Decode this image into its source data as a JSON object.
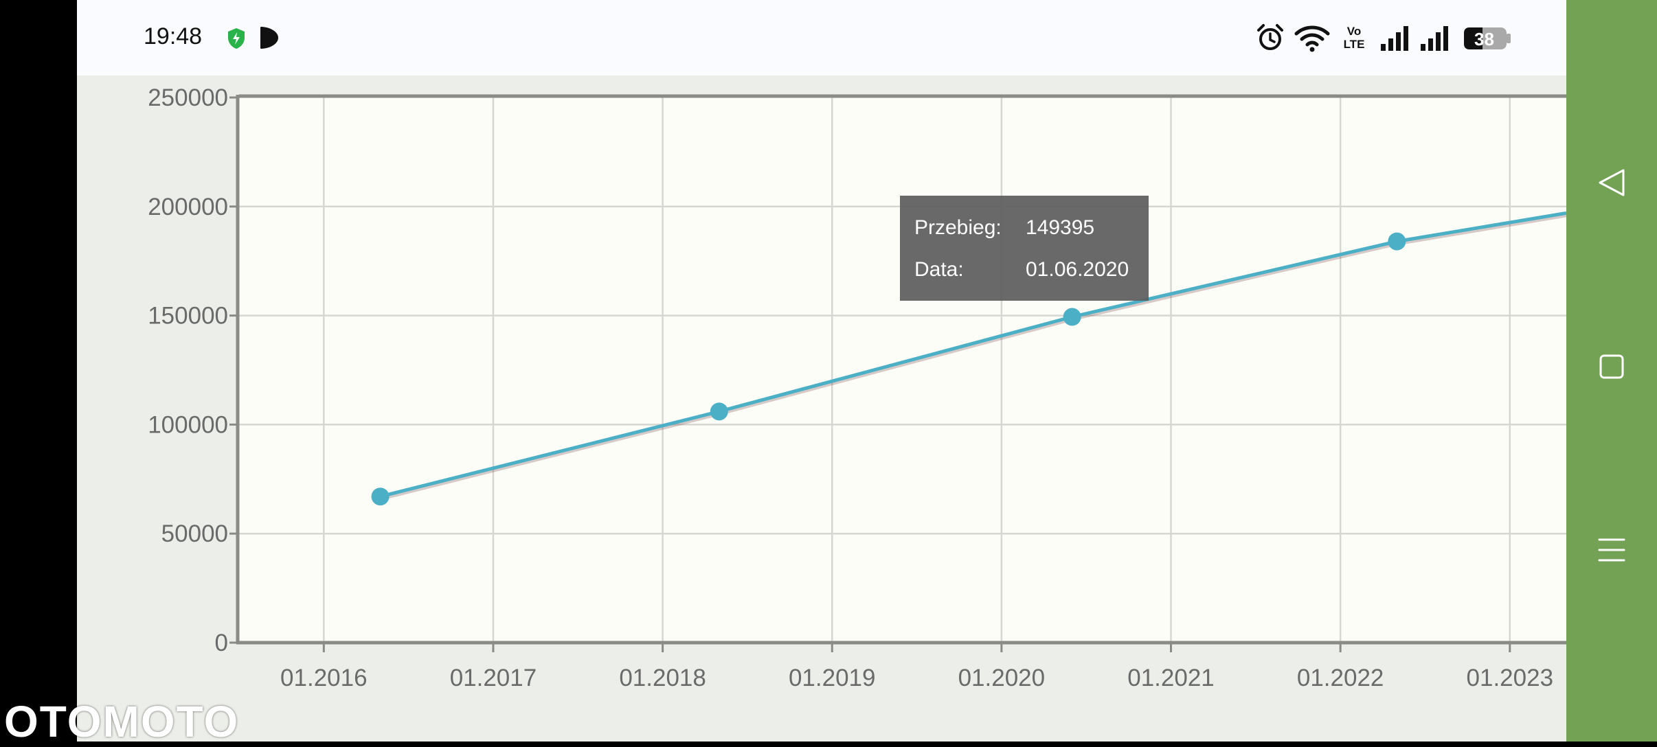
{
  "status_bar": {
    "time": "19:48",
    "battery": "38",
    "icons": [
      "shield-icon",
      "play-icon",
      "alarm-icon",
      "wifi-icon",
      "volte-icon",
      "signal-icon",
      "signal-icon",
      "battery-icon"
    ],
    "volte_text": "Vo LTE"
  },
  "chart_data": {
    "type": "line",
    "x_tick_labels": [
      "01.2016",
      "01.2017",
      "01.2018",
      "01.2019",
      "01.2020",
      "01.2021",
      "01.2022",
      "01.2023"
    ],
    "y_tick_labels": [
      "0",
      "50000",
      "100000",
      "150000",
      "200000",
      "250000"
    ],
    "ylim": [
      0,
      250000
    ],
    "xlim": [
      "2015-07",
      "2023-05"
    ],
    "grid": true,
    "series": [
      {
        "color": "#4bafc6",
        "points": [
          {
            "date": "2016-05",
            "value": 67000
          },
          {
            "date": "2018-05",
            "value": 106000
          },
          {
            "date": "2020-06",
            "value": 149395
          },
          {
            "date": "2022-05",
            "value": 184000
          }
        ],
        "continues_to": {
          "date": "2023-05",
          "value": 197000
        }
      }
    ]
  },
  "tooltip": {
    "mileage_label": "Przebieg:",
    "mileage_value": "149395",
    "date_label": "Data:",
    "date_value": "01.06.2020"
  },
  "watermark": "OTOMOTO",
  "colors": {
    "line": "#4bafc6",
    "plot_background": "#fdfdf8",
    "page_background": "#eceee9",
    "nav_bar": "#73a255"
  },
  "nav_bar": {
    "buttons": [
      "back-icon",
      "home-icon",
      "menu-icon"
    ]
  }
}
